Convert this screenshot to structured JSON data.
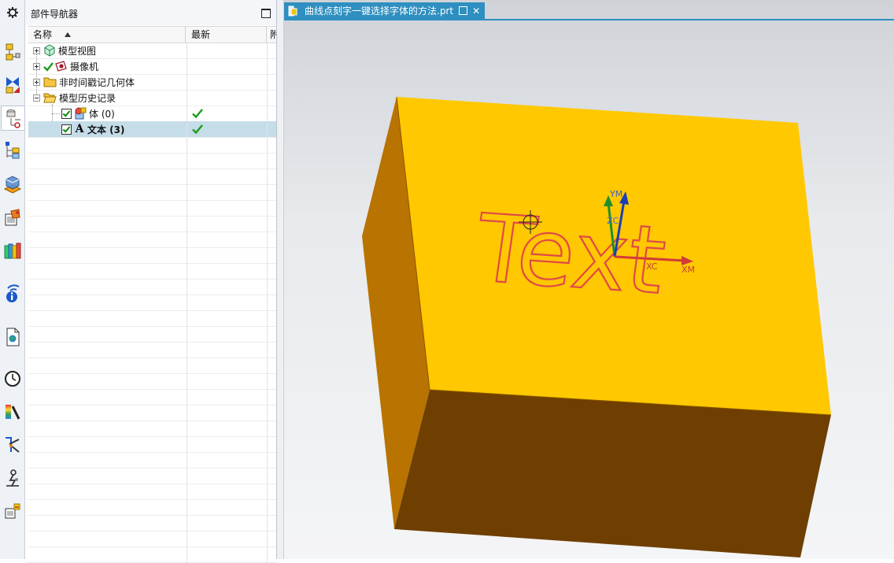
{
  "navigator": {
    "title": "部件导航器",
    "columns": [
      "名称",
      "最新",
      "附"
    ],
    "rows": [
      {
        "label": "模型视图",
        "icon": "model-views-icon"
      },
      {
        "label": "摄像机",
        "icon": "camera-icon"
      },
      {
        "label": "非时间戳记几何体",
        "icon": "folder-icon"
      },
      {
        "label": "模型历史记录",
        "icon": "folder-open-icon"
      },
      {
        "label": "体 (0)",
        "icon": "body-icon",
        "latest": true
      },
      {
        "label": "文本 (3)",
        "icon": "text-icon",
        "latest": true,
        "selected": true
      }
    ]
  },
  "tab": {
    "title": "曲线点刻字一键选择字体的方法.prt"
  },
  "scene": {
    "text": "Text",
    "axis_labels": {
      "ym": "YM",
      "zc": "ZC",
      "xc": "XC",
      "xm": "XM"
    },
    "colors": {
      "top_face": "#FFC800",
      "left_face": "#B87300",
      "front_face": "#6E3F00",
      "text_outline": "#E04848"
    }
  }
}
